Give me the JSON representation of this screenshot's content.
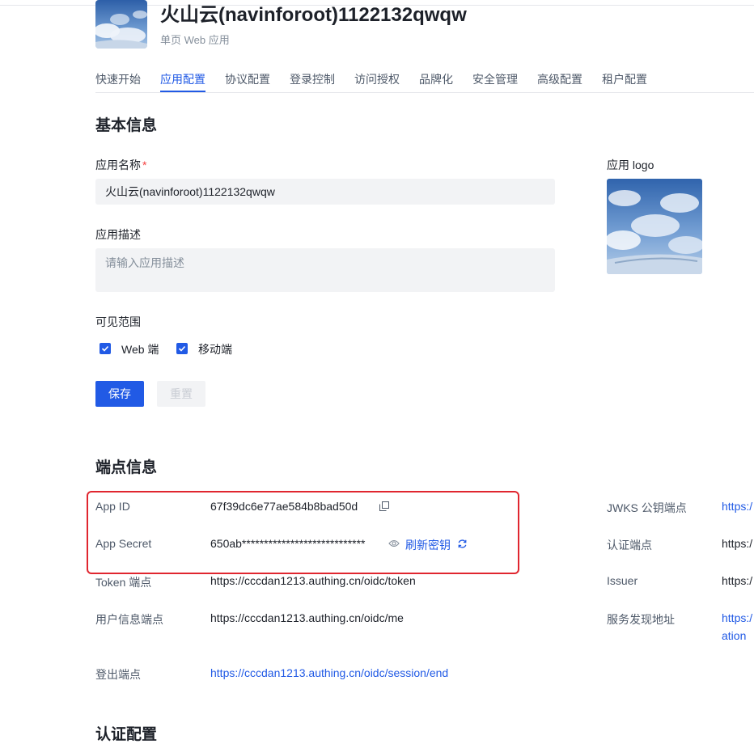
{
  "header": {
    "app_title": "火山云(navinforoot)1122132qwqw",
    "app_type": "单页 Web 应用"
  },
  "tabs": [
    {
      "label": "快速开始"
    },
    {
      "label": "应用配置",
      "active": true
    },
    {
      "label": "协议配置"
    },
    {
      "label": "登录控制"
    },
    {
      "label": "访问授权"
    },
    {
      "label": "品牌化"
    },
    {
      "label": "安全管理"
    },
    {
      "label": "高级配置"
    },
    {
      "label": "租户配置"
    }
  ],
  "basic": {
    "title": "基本信息",
    "name_label": "应用名称",
    "required_mark": "*",
    "name_value": "火山云(navinforoot)1122132qwqw",
    "desc_label": "应用描述",
    "desc_placeholder": "请输入应用描述",
    "logo_label": "应用 logo",
    "visibility_label": "可见范围",
    "visibility_options": [
      {
        "label": "Web 端",
        "checked": true
      },
      {
        "label": "移动端",
        "checked": true
      }
    ],
    "save_label": "保存",
    "reset_label": "重置"
  },
  "endpoints": {
    "title": "端点信息",
    "app_id_label": "App ID",
    "app_id_value": "67f39dc6e77ae584b8bad50d",
    "app_secret_label": "App Secret",
    "app_secret_value": "650ab****************************",
    "refresh_label": "刷新密钥",
    "token_label": "Token 端点",
    "token_value": "https://cccdan1213.authing.cn/oidc/token",
    "userinfo_label": "用户信息端点",
    "userinfo_value": "https://cccdan1213.authing.cn/oidc/me",
    "logout_label": "登出端点",
    "logout_value": "https://cccdan1213.authing.cn/oidc/session/end",
    "jwks_label": "JWKS 公钥端点",
    "jwks_value": "https:/",
    "auth_label": "认证端点",
    "auth_value": "https:/",
    "issuer_label": "Issuer",
    "issuer_value": "https:/",
    "discovery_label": "服务发现地址",
    "discovery_value_1": "https:/",
    "discovery_value_2": "ation"
  },
  "auth_config": {
    "title": "认证配置"
  },
  "colors": {
    "primary": "#215ae5",
    "highlight_box": "#e0262f",
    "input_bg": "#f2f3f5"
  },
  "icons": {
    "copy": "copy-icon",
    "eye": "eye-icon",
    "refresh": "refresh-icon",
    "check": "check-icon"
  }
}
